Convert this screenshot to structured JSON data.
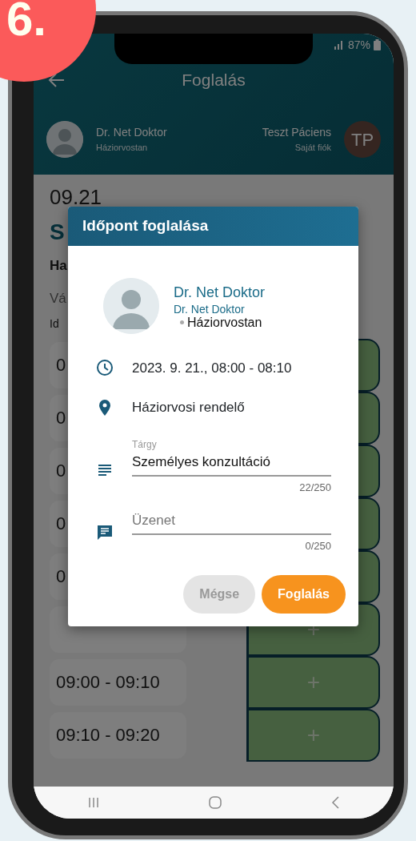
{
  "badge": {
    "text": "6."
  },
  "status_bar": {
    "battery": "87%"
  },
  "app_bar": {
    "title": "Foglalás"
  },
  "header": {
    "doctor_name": "Dr. Net Doktor",
    "doctor_specialty": "Háziorvostan",
    "patient_name": "Teszt Páciens",
    "patient_subtitle": "Saját fiók",
    "patient_initials": "TP"
  },
  "background": {
    "date": "09.21",
    "heading": "S",
    "line_1": "Ha",
    "line_2": "Vá",
    "line_3": "Id"
  },
  "slots": [
    {
      "time": "0"
    },
    {
      "time": "0"
    },
    {
      "time": "0"
    },
    {
      "time": "0"
    },
    {
      "time": "0"
    },
    {
      "plus": "+"
    },
    {
      "time": "09:00 - 09:10",
      "plus": "+"
    },
    {
      "time": "09:10 - 09:20",
      "plus": "+"
    }
  ],
  "dialog": {
    "title": "Időpont foglalása",
    "doctor_name": "Dr. Net Doktor",
    "doctor_subtitle": "Dr. Net Doktor",
    "doctor_specialty": "Háziorvostan",
    "details": [
      {
        "kind": "time",
        "text": "2023. 9. 21., 08:00 - 08:10"
      },
      {
        "kind": "location",
        "text": "Háziorvosi rendelő"
      }
    ],
    "fields": [
      {
        "kind": "subject",
        "label": "Tárgy",
        "value": "Személyes konzultáció",
        "counter": "22/250"
      },
      {
        "kind": "message",
        "placeholder": "Üzenet",
        "counter": "0/250"
      }
    ],
    "buttons": [
      {
        "label": "Mégse",
        "disabled": true
      },
      {
        "label": "Foglalás",
        "disabled": false
      }
    ]
  }
}
